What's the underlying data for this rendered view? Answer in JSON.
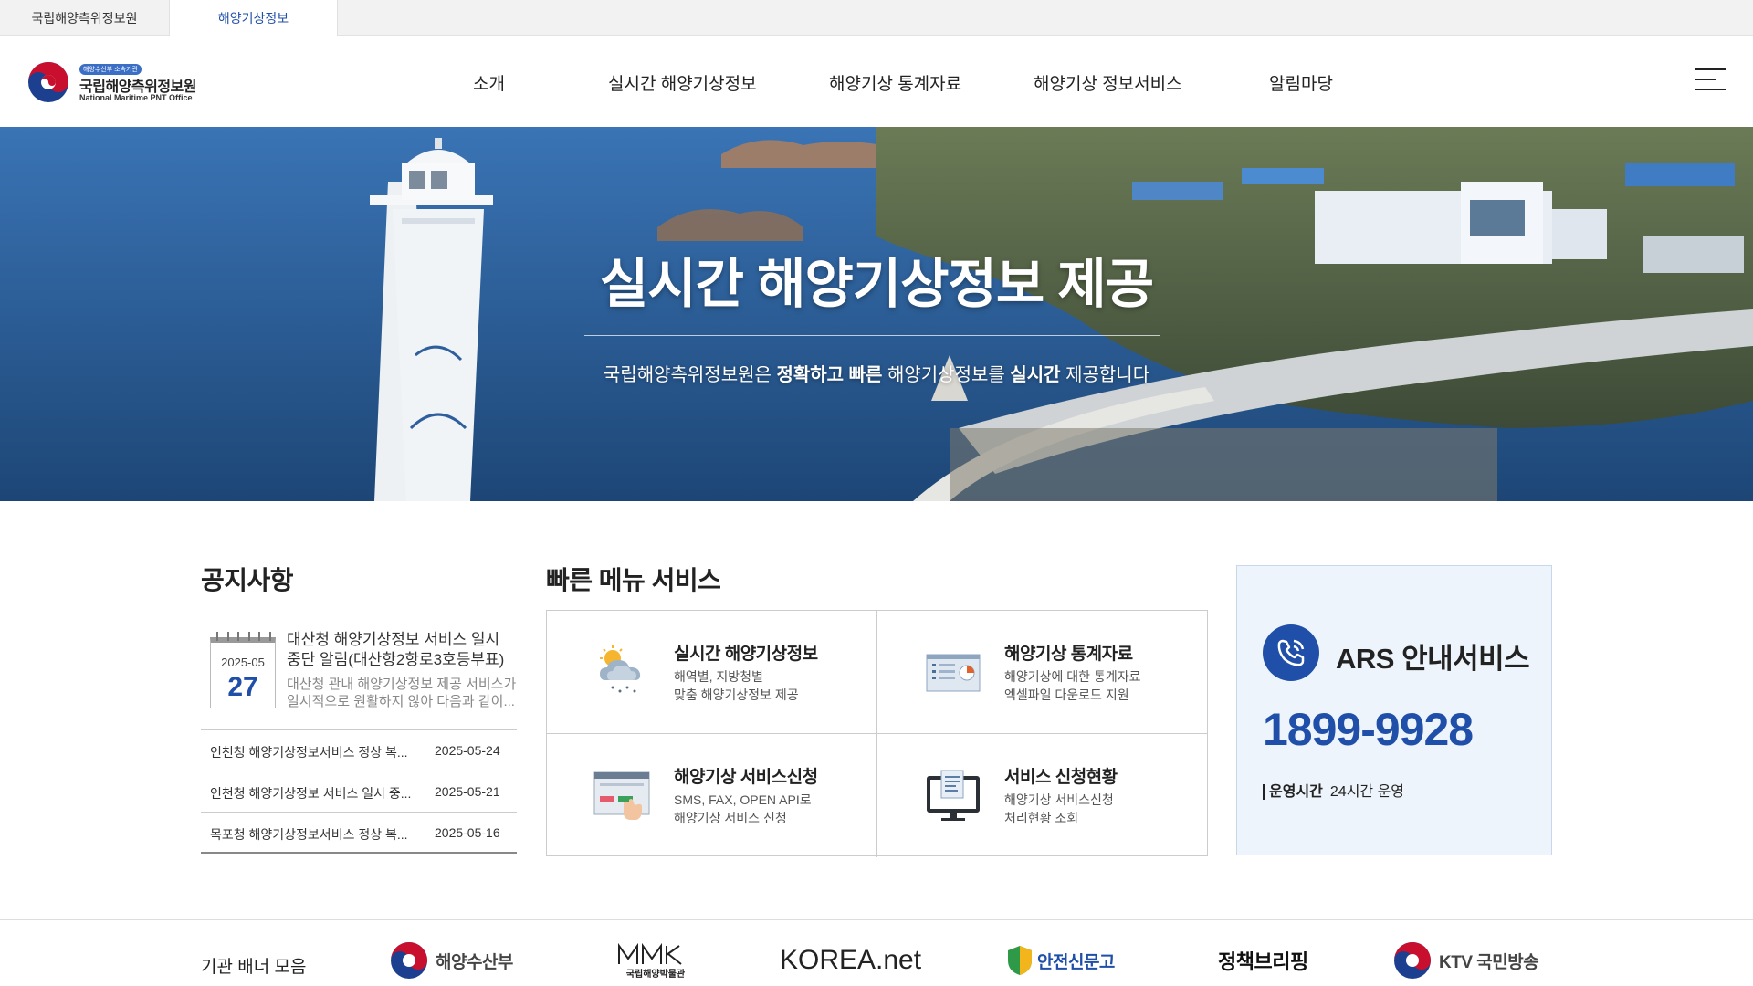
{
  "util_tabs": [
    "국립해양측위정보원",
    "해양기상정보"
  ],
  "logo": {
    "badge": "해양수산부 소속기관",
    "name_kr": "국립해양측위정보원",
    "name_en": "National Maritime PNT Office"
  },
  "nav": [
    "소개",
    "실시간 해양기상정보",
    "해양기상 통계자료",
    "해양기상 정보서비스",
    "알림마당"
  ],
  "hero": {
    "title": "실시간 해양기상정보 제공",
    "sub_1": "국립해양측위정보원은 ",
    "sub_b1": "정확하고 빠른",
    "sub_2": " 해양기상정보를 ",
    "sub_b2": "실시간",
    "sub_3": " 제공합니다"
  },
  "notice": {
    "title": "공지사항",
    "featured": {
      "year_month": "2025-05",
      "day": "27",
      "title": "대산청 해양기상정보 서비스 일시 중단 알림(대산항2항로3호등부표)",
      "body_1": "대산청 관내 해양기상정보 제공 서비스가",
      "body_2": "일시적으로 원활하지 않아 다음과 같이..."
    },
    "rows": [
      {
        "title": "인천청 해양기상정보서비스 정상 복...",
        "date": "2025-05-24"
      },
      {
        "title": "인천청 해양기상정보 서비스 일시 중...",
        "date": "2025-05-21"
      },
      {
        "title": "목포청 해양기상정보서비스 정상 복...",
        "date": "2025-05-16"
      }
    ]
  },
  "quick": {
    "title": "빠른 메뉴 서비스",
    "items": [
      {
        "title": "실시간 해양기상정보",
        "desc_1": "해역별, 지방청별",
        "desc_2": "맞춤 해양기상정보 제공",
        "icon": "weather-icon"
      },
      {
        "title": "해양기상 통계자료",
        "desc_1": "해양기상에 대한 통계자료",
        "desc_2": "엑셀파일 다운로드 지원",
        "icon": "statistics-icon"
      },
      {
        "title": "해양기상 서비스신청",
        "desc_1": "SMS, FAX, OPEN API로",
        "desc_2": "해양기상 서비스 신청",
        "icon": "apply-icon"
      },
      {
        "title": "서비스 신청현황",
        "desc_1": "해양기상 서비스신청",
        "desc_2": "처리현황 조회",
        "icon": "monitor-icon"
      }
    ]
  },
  "ars": {
    "title": "ARS 안내서비스",
    "number": "1899-9928",
    "hours_label": "운영시간",
    "hours_value": "24시간 운영"
  },
  "banners": {
    "title": "기관 배너 모음",
    "items": [
      "해양수산부",
      "국립해양박물관",
      "KOREA.net",
      "안전신문고",
      "정책브리핑",
      "KTV 국민방송"
    ]
  },
  "colors": {
    "accent": "#1f4fa8",
    "ars_bg": "#eef4fb"
  }
}
